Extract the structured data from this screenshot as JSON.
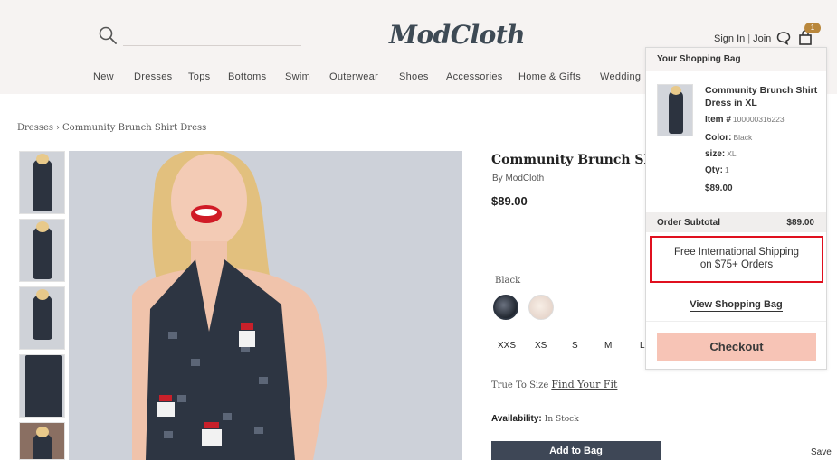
{
  "header": {
    "logo": "ModCloth",
    "search_placeholder": "",
    "sign_in": "Sign In",
    "separator": "|",
    "join": "Join",
    "bag_count": "1"
  },
  "nav": {
    "items": [
      "New",
      "Dresses",
      "Tops",
      "Bottoms",
      "Swim",
      "Outerwear",
      "Shoes",
      "Accessories",
      "Home & Gifts",
      "Wedding"
    ]
  },
  "breadcrumb": {
    "parent": "Dresses",
    "arrow": "›",
    "current": "Community Brunch Shirt Dress"
  },
  "product": {
    "title": "Community Brunch Shirt Dress",
    "by": "By ModCloth",
    "price": "$89.00",
    "color_label": "Black",
    "sizes": [
      "XXS",
      "XS",
      "S",
      "M",
      "L"
    ],
    "fit_prefix": "True To Size",
    "fit_link": "Find Your Fit",
    "availability_label": "Availability:",
    "availability_value": "In Stock",
    "add_button": "Add to Bag",
    "save_text": "Save"
  },
  "bag": {
    "heading": "Your Shopping Bag",
    "item_name": "Community Brunch Shirt Dress in XL",
    "item_label": "Item #",
    "item_number": "100000316223",
    "color_label": "Color:",
    "color_value": "Black",
    "size_label": "size:",
    "size_value": "XL",
    "qty_label": "Qty:",
    "qty_value": "1",
    "item_price": "$89.00",
    "subtotal_label": "Order Subtotal",
    "subtotal_value": "$89.00",
    "promo_line1": "Free International Shipping",
    "promo_line2": "on $75+ Orders",
    "view_bag": "View Shopping Bag",
    "checkout": "Checkout"
  },
  "colors": {
    "header_bg": "#f6f3f2",
    "checkout_bg": "#f7c4b6",
    "promo_border": "#e0101f",
    "add_button_bg": "#3e4756"
  }
}
